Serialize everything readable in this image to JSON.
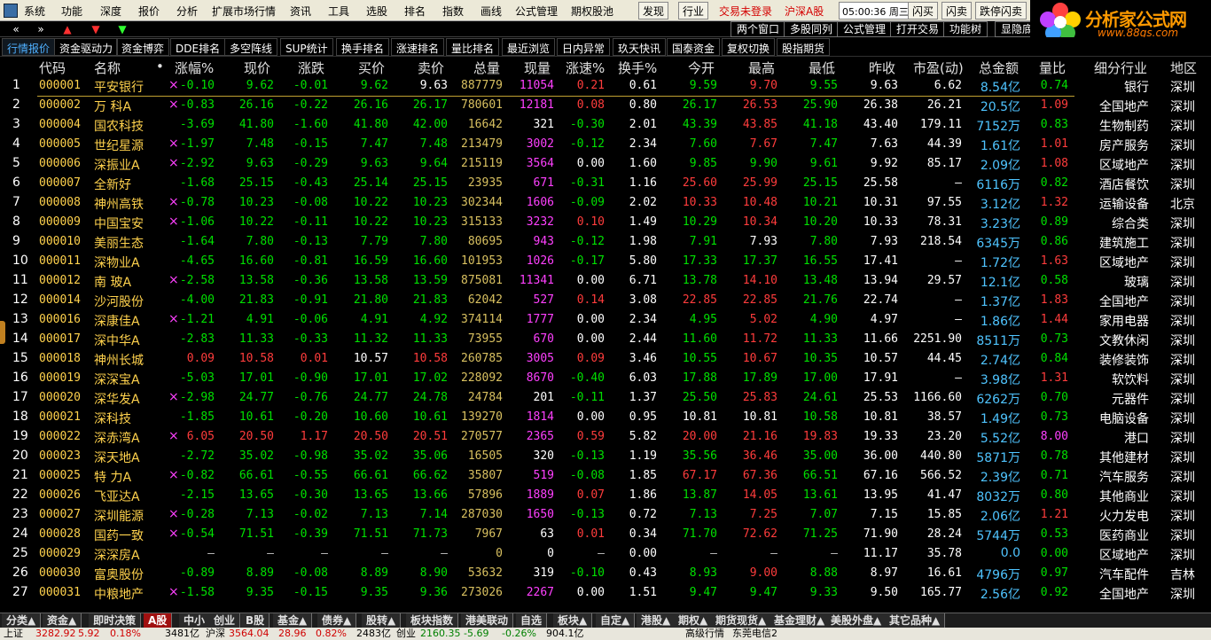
{
  "menu": {
    "items": [
      "系统",
      "功能",
      "深度",
      "报价",
      "分析",
      "扩展市场行情",
      "资讯",
      "工具",
      "选股",
      "排名",
      "指数",
      "画线",
      "公式管理",
      "期权股池"
    ],
    "red_items": [
      "发现",
      "行业",
      "交易未登录",
      "沪深A股"
    ],
    "clock": "05:00:36 周三",
    "right_buttons": [
      "闪买",
      "闪卖",
      "跌停闪卖"
    ]
  },
  "toolbar2": {
    "nav": [
      "«",
      "»",
      "▲",
      "▼",
      "▼"
    ],
    "buttons": [
      "两个窗口",
      "多股同列",
      "公式管理",
      "打开交易",
      "功能树",
      "显隐底"
    ]
  },
  "logo": {
    "text": "分析家公式网",
    "url": "www.88gs.com"
  },
  "tabs": [
    "行情报价",
    "资金驱动力",
    "资金博弈",
    "DDE排名",
    "多空阵线",
    "SUP统计",
    "换手排名",
    "涨速排名",
    "量比排名",
    "最近浏览",
    "日内异常",
    "玖天快讯",
    "国泰资金",
    "复权切换",
    "股指期货"
  ],
  "columns": [
    "代码",
    "名称",
    "•",
    "涨幅%",
    "现价",
    "涨跌",
    "买价",
    "卖价",
    "总量",
    "现量",
    "涨速%",
    "换手%",
    "今开",
    "最高",
    "最低",
    "昨收",
    "市盈(动)",
    "总金额",
    "量比",
    "细分行业",
    "地区"
  ],
  "rows": [
    [
      "1",
      "000001",
      "平安银行",
      "×",
      "-0.10",
      "9.62",
      "-0.01",
      "9.62",
      "9.63",
      "887779",
      "11054",
      "0.21",
      "0.61",
      "9.59",
      "9.70",
      "9.55",
      "9.63",
      "6.62",
      "8.54亿",
      "0.74",
      "银行",
      "深圳"
    ],
    [
      "2",
      "000002",
      "万 科A",
      "×",
      "-0.83",
      "26.16",
      "-0.22",
      "26.16",
      "26.17",
      "780601",
      "12181",
      "0.08",
      "0.80",
      "26.17",
      "26.53",
      "25.90",
      "26.38",
      "26.21",
      "20.5亿",
      "1.09",
      "全国地产",
      "深圳"
    ],
    [
      "3",
      "000004",
      "国农科技",
      "",
      "-3.69",
      "41.80",
      "-1.60",
      "41.80",
      "42.00",
      "16642",
      "321",
      "-0.30",
      "2.01",
      "43.39",
      "43.85",
      "41.18",
      "43.40",
      "179.11",
      "7152万",
      "0.83",
      "生物制药",
      "深圳"
    ],
    [
      "4",
      "000005",
      "世纪星源",
      "×",
      "-1.97",
      "7.48",
      "-0.15",
      "7.47",
      "7.48",
      "213479",
      "3002",
      "-0.12",
      "2.34",
      "7.60",
      "7.67",
      "7.47",
      "7.63",
      "44.39",
      "1.61亿",
      "1.01",
      "房产服务",
      "深圳"
    ],
    [
      "5",
      "000006",
      "深振业A",
      "×",
      "-2.92",
      "9.63",
      "-0.29",
      "9.63",
      "9.64",
      "215119",
      "3564",
      "0.00",
      "1.60",
      "9.85",
      "9.90",
      "9.61",
      "9.92",
      "85.17",
      "2.09亿",
      "1.08",
      "区域地产",
      "深圳"
    ],
    [
      "6",
      "000007",
      "全新好",
      "",
      "-1.68",
      "25.15",
      "-0.43",
      "25.14",
      "25.15",
      "23935",
      "671",
      "-0.31",
      "1.16",
      "25.60",
      "25.99",
      "25.15",
      "25.58",
      "—",
      "6116万",
      "0.82",
      "酒店餐饮",
      "深圳"
    ],
    [
      "7",
      "000008",
      "神州高铁",
      "×",
      "-0.78",
      "10.23",
      "-0.08",
      "10.22",
      "10.23",
      "302344",
      "1606",
      "-0.09",
      "2.02",
      "10.33",
      "10.48",
      "10.21",
      "10.31",
      "97.55",
      "3.12亿",
      "1.32",
      "运输设备",
      "北京"
    ],
    [
      "8",
      "000009",
      "中国宝安",
      "×",
      "-1.06",
      "10.22",
      "-0.11",
      "10.22",
      "10.23",
      "315133",
      "3232",
      "0.10",
      "1.49",
      "10.29",
      "10.34",
      "10.20",
      "10.33",
      "78.31",
      "3.23亿",
      "0.89",
      "综合类",
      "深圳"
    ],
    [
      "9",
      "000010",
      "美丽生态",
      "",
      "-1.64",
      "7.80",
      "-0.13",
      "7.79",
      "7.80",
      "80695",
      "943",
      "-0.12",
      "1.98",
      "7.91",
      "7.93",
      "7.80",
      "7.93",
      "218.54",
      "6345万",
      "0.86",
      "建筑施工",
      "深圳"
    ],
    [
      "10",
      "000011",
      "深物业A",
      "",
      "-4.65",
      "16.60",
      "-0.81",
      "16.59",
      "16.60",
      "101953",
      "1026",
      "-0.17",
      "5.80",
      "17.33",
      "17.37",
      "16.55",
      "17.41",
      "—",
      "1.72亿",
      "1.63",
      "区域地产",
      "深圳"
    ],
    [
      "11",
      "000012",
      "南 玻A",
      "×",
      "-2.58",
      "13.58",
      "-0.36",
      "13.58",
      "13.59",
      "875081",
      "11341",
      "0.00",
      "6.71",
      "13.78",
      "14.10",
      "13.48",
      "13.94",
      "29.57",
      "12.1亿",
      "0.58",
      "玻璃",
      "深圳"
    ],
    [
      "12",
      "000014",
      "沙河股份",
      "",
      "-4.00",
      "21.83",
      "-0.91",
      "21.80",
      "21.83",
      "62042",
      "527",
      "0.14",
      "3.08",
      "22.85",
      "22.85",
      "21.76",
      "22.74",
      "—",
      "1.37亿",
      "1.83",
      "全国地产",
      "深圳"
    ],
    [
      "13",
      "000016",
      "深康佳A",
      "×",
      "-1.21",
      "4.91",
      "-0.06",
      "4.91",
      "4.92",
      "374114",
      "1777",
      "0.00",
      "2.34",
      "4.95",
      "5.02",
      "4.90",
      "4.97",
      "—",
      "1.86亿",
      "1.44",
      "家用电器",
      "深圳"
    ],
    [
      "14",
      "000017",
      "深中华A",
      "",
      "-2.83",
      "11.33",
      "-0.33",
      "11.32",
      "11.33",
      "73955",
      "670",
      "0.00",
      "2.44",
      "11.60",
      "11.72",
      "11.33",
      "11.66",
      "2251.90",
      "8511万",
      "0.73",
      "文教休闲",
      "深圳"
    ],
    [
      "15",
      "000018",
      "神州长城",
      "",
      "0.09",
      "10.58",
      "0.01",
      "10.57",
      "10.58",
      "260785",
      "3005",
      "0.09",
      "3.46",
      "10.55",
      "10.67",
      "10.35",
      "10.57",
      "44.45",
      "2.74亿",
      "0.84",
      "装修装饰",
      "深圳"
    ],
    [
      "16",
      "000019",
      "深深宝A",
      "",
      "-5.03",
      "17.01",
      "-0.90",
      "17.01",
      "17.02",
      "228092",
      "8670",
      "-0.40",
      "6.03",
      "17.88",
      "17.89",
      "17.00",
      "17.91",
      "—",
      "3.98亿",
      "1.31",
      "软饮料",
      "深圳"
    ],
    [
      "17",
      "000020",
      "深华发A",
      "×",
      "-2.98",
      "24.77",
      "-0.76",
      "24.77",
      "24.78",
      "24784",
      "201",
      "-0.11",
      "1.37",
      "25.50",
      "25.83",
      "24.61",
      "25.53",
      "1166.60",
      "6262万",
      "0.70",
      "元器件",
      "深圳"
    ],
    [
      "18",
      "000021",
      "深科技",
      "",
      "-1.85",
      "10.61",
      "-0.20",
      "10.60",
      "10.61",
      "139270",
      "1814",
      "0.00",
      "0.95",
      "10.81",
      "10.81",
      "10.58",
      "10.81",
      "38.57",
      "1.49亿",
      "0.73",
      "电脑设备",
      "深圳"
    ],
    [
      "19",
      "000022",
      "深赤湾A",
      "×",
      "6.05",
      "20.50",
      "1.17",
      "20.50",
      "20.51",
      "270577",
      "2365",
      "0.59",
      "5.82",
      "20.00",
      "21.16",
      "19.83",
      "19.33",
      "23.20",
      "5.52亿",
      "8.00",
      "港口",
      "深圳"
    ],
    [
      "20",
      "000023",
      "深天地A",
      "",
      "-2.72",
      "35.02",
      "-0.98",
      "35.02",
      "35.06",
      "16505",
      "320",
      "-0.13",
      "1.19",
      "35.56",
      "36.46",
      "35.00",
      "36.00",
      "440.80",
      "5871万",
      "0.78",
      "其他建材",
      "深圳"
    ],
    [
      "21",
      "000025",
      "特 力A",
      "×",
      "-0.82",
      "66.61",
      "-0.55",
      "66.61",
      "66.62",
      "35807",
      "519",
      "-0.08",
      "1.85",
      "67.17",
      "67.36",
      "66.51",
      "67.16",
      "566.52",
      "2.39亿",
      "0.71",
      "汽车服务",
      "深圳"
    ],
    [
      "22",
      "000026",
      "飞亚达A",
      "",
      "-2.15",
      "13.65",
      "-0.30",
      "13.65",
      "13.66",
      "57896",
      "1889",
      "0.07",
      "1.86",
      "13.87",
      "14.05",
      "13.61",
      "13.95",
      "41.47",
      "8032万",
      "0.80",
      "其他商业",
      "深圳"
    ],
    [
      "23",
      "000027",
      "深圳能源",
      "×",
      "-0.28",
      "7.13",
      "-0.02",
      "7.13",
      "7.14",
      "287030",
      "1650",
      "-0.13",
      "0.72",
      "7.13",
      "7.25",
      "7.07",
      "7.15",
      "15.85",
      "2.06亿",
      "1.21",
      "火力发电",
      "深圳"
    ],
    [
      "24",
      "000028",
      "国药一致",
      "×",
      "-0.54",
      "71.51",
      "-0.39",
      "71.51",
      "71.73",
      "7967",
      "63",
      "0.01",
      "0.34",
      "71.70",
      "72.62",
      "71.25",
      "71.90",
      "28.24",
      "5744万",
      "0.53",
      "医药商业",
      "深圳"
    ],
    [
      "25",
      "000029",
      "深深房A",
      "",
      "—",
      "—",
      "—",
      "—",
      "—",
      "0",
      "0",
      "—",
      "0.00",
      "—",
      "—",
      "—",
      "11.17",
      "35.78",
      "0.0",
      "0.00",
      "区域地产",
      "深圳"
    ],
    [
      "26",
      "000030",
      "富奥股份",
      "",
      "-0.89",
      "8.89",
      "-0.08",
      "8.89",
      "8.90",
      "53632",
      "319",
      "-0.10",
      "0.43",
      "8.93",
      "9.00",
      "8.88",
      "8.97",
      "16.61",
      "4796万",
      "0.97",
      "汽车配件",
      "吉林"
    ],
    [
      "27",
      "000031",
      "中粮地产",
      "×",
      "-1.58",
      "9.35",
      "-0.15",
      "9.35",
      "9.36",
      "273026",
      "2267",
      "0.00",
      "1.51",
      "9.47",
      "9.47",
      "9.33",
      "9.50",
      "165.77",
      "2.56亿",
      "0.92",
      "全国地产",
      "深圳"
    ]
  ],
  "bottom_tabs": [
    "分类▲",
    "资金▲",
    "即时决策",
    "A股",
    "中小",
    "创业",
    "B股",
    "基金▲",
    "债券▲",
    "股转▲",
    "板块指数",
    "港美联动",
    "自选",
    "板块▲",
    "自定▲",
    "港股▲",
    "期权▲",
    "期货现货▲",
    "基金理财▲",
    "美股外盘▲",
    "其它品种▲"
  ],
  "ticker": [
    {
      "t": "上证",
      "c": "tkblk"
    },
    {
      "t": "3282.92",
      "c": "tkred"
    },
    {
      "t": "5.92",
      "c": "tkred"
    },
    {
      "t": "0.18%",
      "c": "tkred"
    },
    {
      "t": "3481亿",
      "c": "tkblk"
    },
    {
      "t": "沪深",
      "c": "tkblk"
    },
    {
      "t": "3564.04",
      "c": "tkred"
    },
    {
      "t": "28.96",
      "c": "tkred"
    },
    {
      "t": "0.82%",
      "c": "tkred"
    },
    {
      "t": "2483亿",
      "c": "tkblk"
    },
    {
      "t": "创业",
      "c": "tkblk"
    },
    {
      "t": "2160.35",
      "c": "tkgrn"
    },
    {
      "t": "-5.69",
      "c": "tkgrn"
    },
    {
      "t": "-0.26%",
      "c": "tkgrn"
    },
    {
      "t": "904.1亿",
      "c": "tkblk"
    },
    {
      "t": "高级行情",
      "c": "tkblk"
    },
    {
      "t": "东莞电信2",
      "c": "tkblk"
    }
  ]
}
